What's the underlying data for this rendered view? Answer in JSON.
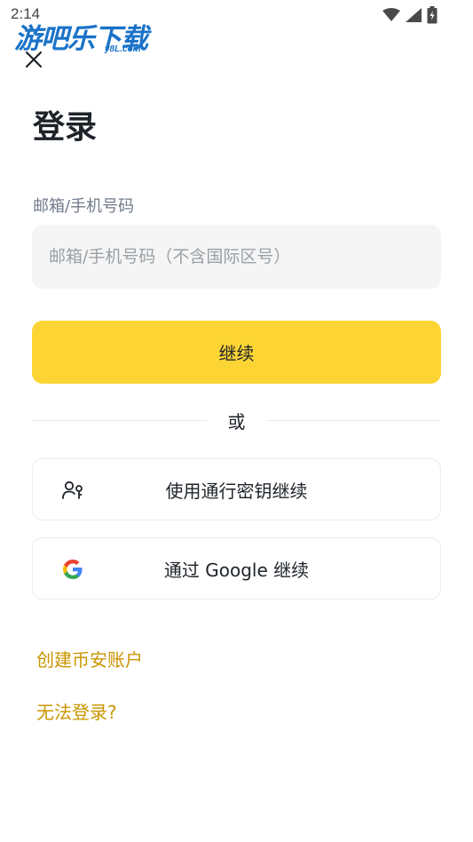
{
  "status_bar": {
    "time": "2:14",
    "icons": [
      "wifi-icon",
      "signal-icon",
      "battery-icon"
    ]
  },
  "watermark": {
    "main_text": "游吧乐下载",
    "sub_text": "y8L.com"
  },
  "header": {
    "close_icon": "close-icon",
    "title": "登录"
  },
  "form": {
    "label": "邮箱/手机号码",
    "input_placeholder": "邮箱/手机号码（不含国际区号）",
    "input_value": "",
    "continue_label": "继续"
  },
  "divider": {
    "text": "或"
  },
  "alt_options": {
    "passkey": {
      "label": "使用通行密钥继续",
      "icon": "passkey-icon"
    },
    "google": {
      "label": "通过 Google 继续",
      "icon": "google-icon"
    }
  },
  "links": {
    "create_account": "创建币安账户",
    "cant_login": "无法登录?"
  },
  "colors": {
    "brand_yellow": "#fcd535",
    "link_gold": "#c99400",
    "input_bg": "#f5f5f5",
    "text_primary": "#1e2329",
    "text_secondary": "#707a8a"
  }
}
